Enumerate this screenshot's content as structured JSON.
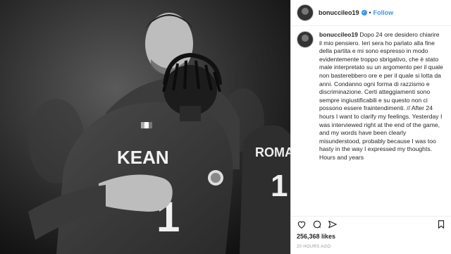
{
  "post": {
    "username": "bonucci​leo19",
    "follow_label": "Follow",
    "separator": "•",
    "caption_user": "bonucci​leo19",
    "caption_text": " Dopo 24 ore desidero chiarire il mio pensiero. Ieri sera ho parlato alla fine della partita e mi sono espresso in modo evidentemente troppo sbrigativo, che è stato male interpretato su un argomento per il quale non basterebbero ore e per il quale si lotta da anni. Condanno ogni forma di razzismo e discriminazione. Certi atteggiamenti sono sempre ingiustificabili e su questo non ci possono essere fraintendimenti. // After 24 hours I want to clarify my feelings. Yesterday I was interviewed right at the end of the game, and my words have been clearly misunderstood, probably because I was too hasty in the way I expressed my thoughts. Hours and years",
    "likes": "256,368 likes",
    "time_ago": "20 HOURS AGO"
  },
  "photo": {
    "jersey_name_front": "KEAN",
    "jersey_name_back": "ROMA",
    "jersey_number_back": "1"
  },
  "icons": {
    "heart": "heart-icon",
    "comment": "comment-icon",
    "share": "share-icon",
    "bookmark": "bookmark-icon",
    "verified": "verified-badge-icon"
  },
  "colors": {
    "accent": "#3897f0",
    "text": "#262626",
    "muted": "#999999"
  }
}
